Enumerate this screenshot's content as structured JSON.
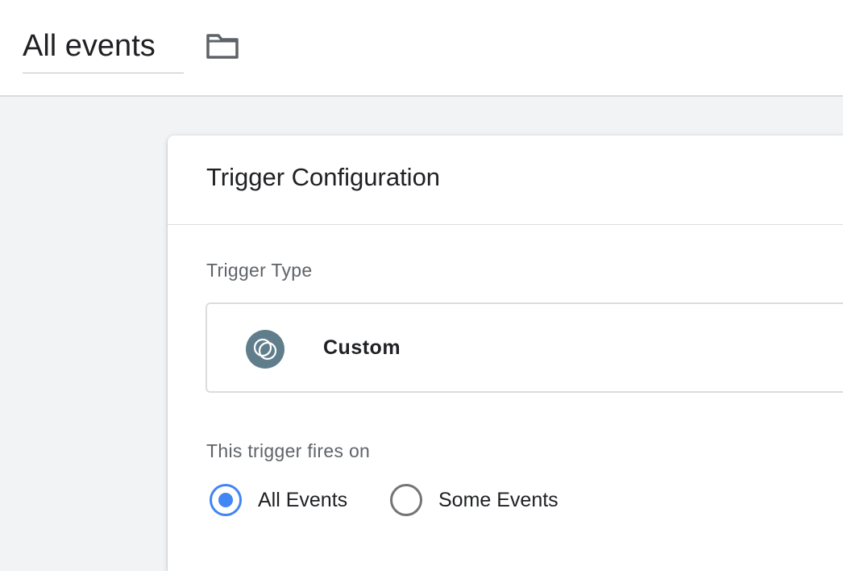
{
  "header": {
    "title": "All events",
    "folder_icon": "folder-icon"
  },
  "card": {
    "title": "Trigger Configuration",
    "trigger_type": {
      "label": "Trigger Type",
      "selected": {
        "name": "Custom",
        "icon": "custom-event-icon",
        "icon_color": "#607d8b"
      }
    },
    "fires_on": {
      "label": "This trigger fires on",
      "options": [
        {
          "label": "All Events",
          "checked": true
        },
        {
          "label": "Some Events",
          "checked": false
        }
      ]
    }
  },
  "colors": {
    "accent": "#4285f4",
    "background": "#f1f3f4",
    "surface": "#ffffff",
    "divider": "#dadce0"
  }
}
